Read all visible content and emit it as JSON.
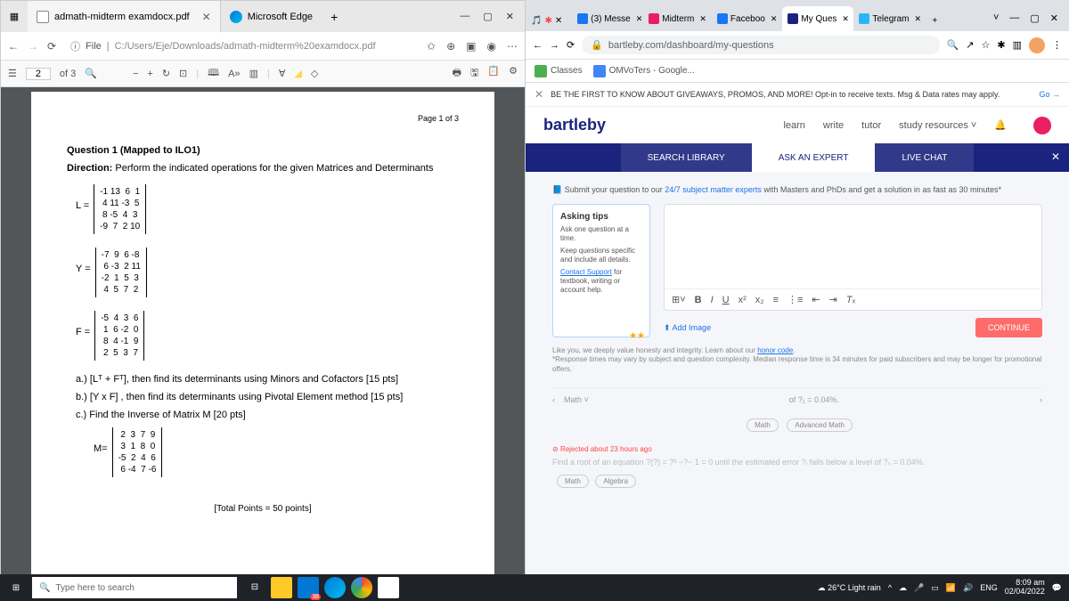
{
  "edge": {
    "tab_title": "admath-midterm examdocx.pdf",
    "app_name": "Microsoft Edge",
    "url_prefix": "File",
    "url": "C:/Users/Eje/Downloads/admath-midterm%20examdocx.pdf",
    "page_current": "2",
    "page_total": "of 3",
    "pdf_page_indicator": "Page 1 of 3"
  },
  "pdf": {
    "q1_title": "Question 1 (Mapped to ILO1)",
    "direction_label": "Direction:",
    "direction_text": " Perform the indicated operations for the given Matrices and Determinants",
    "L_label": "L =",
    "L_rows": "-1 13  6  1\n 4 11 -3  5\n 8 -5  4  3\n-9  7  2 10",
    "Y_label": "Y =",
    "Y_rows": "-7  9  6 -8\n 6 -3  2 11\n-2  1  5  3\n 4  5  7  2",
    "F_label": "F =",
    "F_rows": "-5  4  3  6\n 1  6 -2  0\n 8  4 -1  9\n 2  5  3  7",
    "item_a": "a.) [Lᵀ + Fᵀ], then find its determinants using Minors and Cofactors [15 pts]",
    "item_b": "b.) [Y x F] , then find its determinants using Pivotal Element method [15 pts]",
    "item_c": "c.)  Find the Inverse of Matrix M [20 pts]",
    "M_label": "M=",
    "M_rows": " 2  3  7  9\n 3  1  8  0\n-5  2  4  6\n 6 -4  7 -6",
    "total": "[Total Points = 50 points]"
  },
  "chrome": {
    "tabs": [
      {
        "label": "(3) Messe",
        "color": "#1877f2"
      },
      {
        "label": "Midterm",
        "color": "#e91e63"
      },
      {
        "label": "Faceboo",
        "color": "#1877f2"
      },
      {
        "label": "My Ques",
        "color": "#1a237e",
        "active": true
      },
      {
        "label": "Telegram",
        "color": "#29b6f6"
      }
    ],
    "url": "bartleby.com/dashboard/my-questions",
    "bookmarks": [
      {
        "label": "Classes",
        "color": "#4caf50"
      },
      {
        "label": "OMVoTers - Google...",
        "color": "#4285f4"
      }
    ]
  },
  "bartleby": {
    "banner": "BE THE FIRST TO KNOW ABOUT GIVEAWAYS, PROMOS, AND MORE! Opt-in to receive texts. Msg & Data rates may apply.",
    "banner_go": "Go →",
    "logo": "bartleby",
    "nav": [
      "learn",
      "write",
      "tutor",
      "study resources ˅"
    ],
    "tabs": [
      "SEARCH LIBRARY",
      "ASK AN EXPERT",
      "LIVE CHAT"
    ],
    "submit_pre": "Submit your question to our ",
    "submit_hl": "24/7 subject matter experts",
    "submit_post": " with Masters and PhDs and get a solution in as fast as 30 minutes*",
    "tips_title": "Asking tips",
    "tip1": "Ask one question at a time.",
    "tip2": "Keep questions specific and include all details.",
    "tip3a": "Contact Support",
    "tip3b": " for textbook, writing or account help.",
    "add_image": "⬆ Add Image",
    "continue": "CONTINUE",
    "disclaimer1": "Like you, we deeply value honesty and integrity. Learn about our ",
    "honor": "honor code",
    "disclaimer2": "*Response times may vary by subject and question complexity. Median response time is 34 minutes for paid subscribers and may be longer for promotional offers.",
    "history_subject": "Math ˅",
    "history_text": "of ?₁ = 0.04%.",
    "tag_math": "Math",
    "tag_adv": "Advanced Math",
    "rejected": "Rejected about 23 hours ago",
    "rejected_q": "Find a root of an equation ?(?) = ?³ −?− 1 = 0 until the estimated error ?ᵢ falls below a level of ?ₛ = 0.04%.",
    "tag_algebra": "Algebra"
  },
  "taskbar": {
    "search_placeholder": "Type here to search",
    "weather": "26°C  Light rain",
    "lang": "ENG",
    "time": "8:09 am",
    "date": "02/04/2022",
    "badge": "38"
  }
}
